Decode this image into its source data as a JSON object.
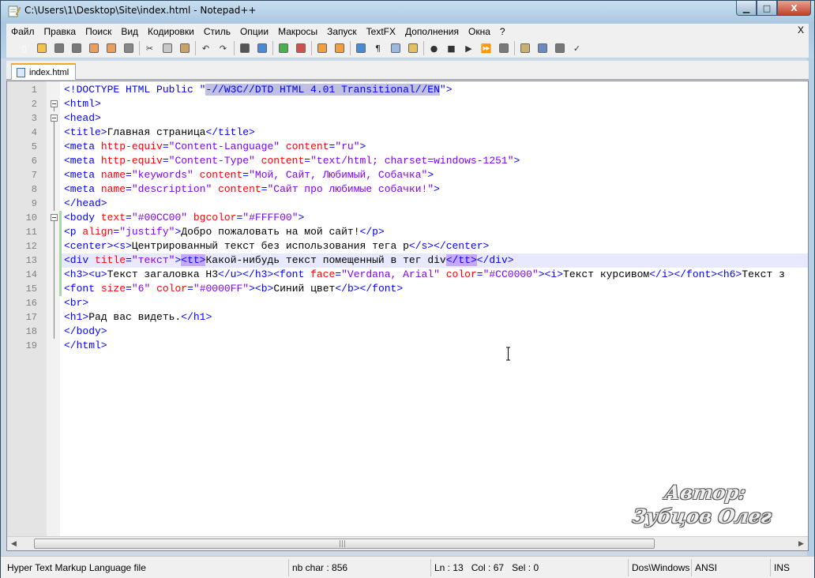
{
  "window": {
    "title": "C:\\Users\\1\\Desktop\\Site\\index.html - Notepad++",
    "min_symbol": "▁",
    "max_symbol": "□",
    "close_symbol": "X"
  },
  "menu": {
    "items": [
      "Файл",
      "Правка",
      "Поиск",
      "Вид",
      "Кодировки",
      "Стиль",
      "Опции",
      "Макросы",
      "Запуск",
      "TextFX",
      "Дополнения",
      "Окна",
      "?"
    ],
    "close": "X"
  },
  "toolbar": {
    "icons": [
      {
        "name": "new-file-icon",
        "glyph": "▯",
        "color": "#ffffff"
      },
      {
        "name": "open-file-icon",
        "glyph": "",
        "color": "#f2c14e"
      },
      {
        "name": "save-icon",
        "glyph": "",
        "color": "#7a7a7a"
      },
      {
        "name": "save-all-icon",
        "glyph": "",
        "color": "#7a7a7a"
      },
      {
        "name": "close-file-icon",
        "glyph": "",
        "color": "#e8a060"
      },
      {
        "name": "close-all-icon",
        "glyph": "",
        "color": "#e8a060"
      },
      {
        "name": "print-icon",
        "glyph": "",
        "color": "#888888"
      },
      {
        "sep": true
      },
      {
        "name": "cut-icon",
        "glyph": "✂",
        "color": ""
      },
      {
        "name": "copy-icon",
        "glyph": "",
        "color": "#c8c8c8"
      },
      {
        "name": "paste-icon",
        "glyph": "",
        "color": "#c9a36a"
      },
      {
        "sep": true
      },
      {
        "name": "undo-icon",
        "glyph": "↶",
        "color": ""
      },
      {
        "name": "redo-icon",
        "glyph": "↷",
        "color": ""
      },
      {
        "sep": true
      },
      {
        "name": "find-icon",
        "glyph": "",
        "color": "#555555"
      },
      {
        "name": "replace-icon",
        "glyph": "",
        "color": "#4a8ad4"
      },
      {
        "sep": true
      },
      {
        "name": "zoom-in-icon",
        "glyph": "",
        "color": "#4caf50"
      },
      {
        "name": "zoom-out-icon",
        "glyph": "",
        "color": "#d05050"
      },
      {
        "sep": true
      },
      {
        "name": "sync-vertical-icon",
        "glyph": "",
        "color": "#f0a040"
      },
      {
        "name": "sync-horizontal-icon",
        "glyph": "",
        "color": "#f0a040"
      },
      {
        "sep": true
      },
      {
        "name": "word-wrap-icon",
        "glyph": "",
        "color": "#4a8ad4"
      },
      {
        "name": "show-all-chars-icon",
        "glyph": "¶",
        "color": ""
      },
      {
        "name": "indent-guide-icon",
        "glyph": "",
        "color": "#9ab8e0"
      },
      {
        "name": "user-language-icon",
        "glyph": "",
        "color": "#e0c060"
      },
      {
        "sep": true
      },
      {
        "name": "record-macro-icon",
        "glyph": "●",
        "color": ""
      },
      {
        "name": "stop-record-icon",
        "glyph": "■",
        "color": ""
      },
      {
        "name": "play-macro-icon",
        "glyph": "▶",
        "color": ""
      },
      {
        "name": "play-multiple-icon",
        "glyph": "⏩",
        "color": ""
      },
      {
        "name": "save-macro-icon",
        "glyph": "",
        "color": "#7a7a7a"
      },
      {
        "sep": true
      },
      {
        "name": "tool-1-icon",
        "glyph": "",
        "color": "#c8b070"
      },
      {
        "name": "tool-2-icon",
        "glyph": "",
        "color": "#6a8ac0"
      },
      {
        "name": "tool-3-icon",
        "glyph": "",
        "color": "#777777"
      },
      {
        "name": "spellcheck-icon",
        "glyph": "✓",
        "color": ""
      }
    ]
  },
  "tab": {
    "label": "index.html"
  },
  "editor": {
    "lines": [
      "1",
      "2",
      "3",
      "4",
      "5",
      "6",
      "7",
      "8",
      "9",
      "10",
      "11",
      "12",
      "13",
      "14",
      "15",
      "16",
      "17",
      "18",
      "19"
    ],
    "current_line_index": 12
  },
  "watermark": {
    "line1": "Автор:",
    "line2": "Зубцов Олег"
  },
  "status": {
    "file_type": "Hyper Text Markup Language file",
    "chars": "nb char : 856",
    "line": "Ln : 13",
    "col": "Col : 67",
    "sel": "Sel : 0",
    "eol": "Dos\\Windows",
    "encoding": "ANSI",
    "mode": "INS"
  }
}
